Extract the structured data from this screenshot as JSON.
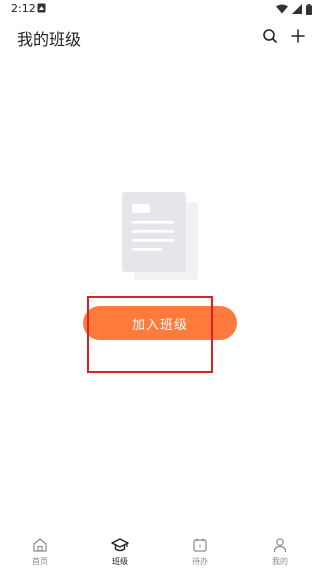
{
  "status_bar": {
    "time": "2:12"
  },
  "header": {
    "title": "我的班级",
    "search_icon": "search-icon",
    "add_icon": "plus-icon"
  },
  "empty_state": {
    "illustration": "document-icon",
    "join_button_label": "加入班级"
  },
  "tab_bar": {
    "items": [
      {
        "label": "首页",
        "icon": "home-icon",
        "active": false
      },
      {
        "label": "班级",
        "icon": "graduation-cap-icon",
        "active": true
      },
      {
        "label": "待办",
        "icon": "calendar-icon",
        "active": false
      },
      {
        "label": "我的",
        "icon": "person-icon",
        "active": false
      }
    ]
  },
  "colors": {
    "accent": "#ff7a3d",
    "highlight": "#e02020",
    "inactive": "#8a8a8a"
  }
}
